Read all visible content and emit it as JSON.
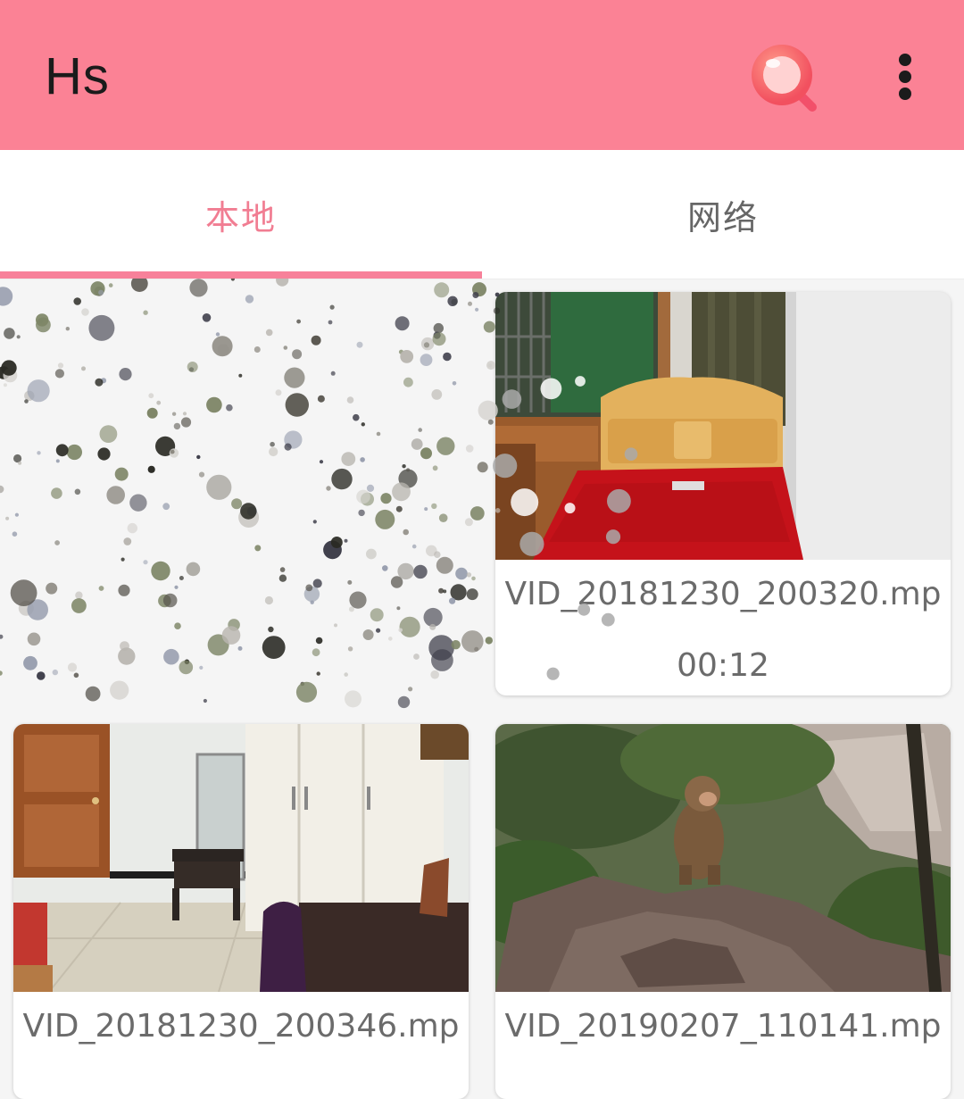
{
  "app": {
    "title": "Hs"
  },
  "toolbar": {
    "search_icon": "search-icon",
    "more_icon": "more-vert-icon"
  },
  "tabs": [
    {
      "label": "本地",
      "selected": true
    },
    {
      "label": "网络",
      "selected": false
    }
  ],
  "videos": [
    {
      "name": "VID_20181230_200320.mp",
      "duration": "00:12",
      "thumbnail": "bedroom with red bedspread"
    },
    {
      "name": "VID_20181230_200346.mp",
      "thumbnail": "room with wardrobe and mirror"
    },
    {
      "name": "VID_20190207_110141.mp",
      "thumbnail": "monkey sitting on rocks"
    }
  ],
  "colors": {
    "appbar": "#fb8295",
    "accent": "#f17d92",
    "tab_inactive": "#666666",
    "indicator": "#f7819a"
  }
}
